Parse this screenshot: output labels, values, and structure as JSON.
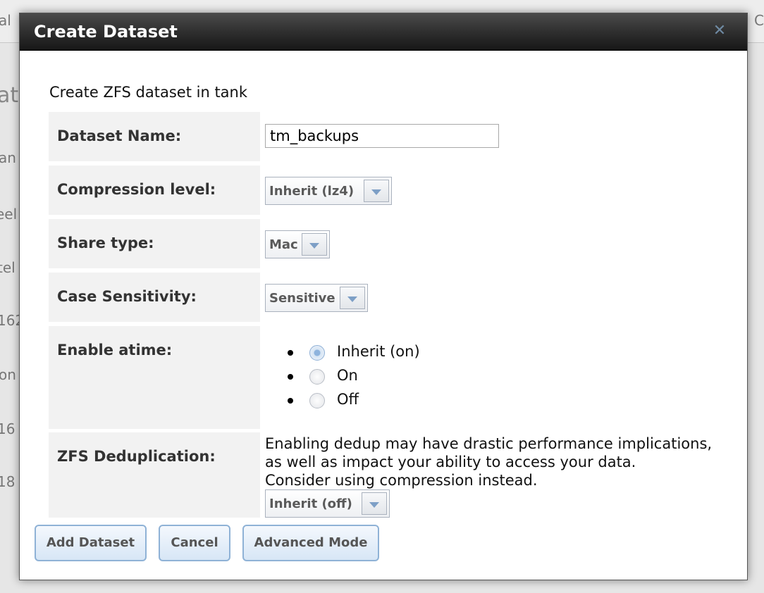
{
  "background": {
    "fragments": [
      "al",
      "C",
      "ati",
      "an",
      "eel",
      "tel",
      "162",
      "on",
      "16",
      "18"
    ]
  },
  "dialog": {
    "title": "Create Dataset",
    "close_icon": "close-icon",
    "subtitle": "Create ZFS dataset in tank",
    "fields": {
      "dataset_name": {
        "label": "Dataset Name:",
        "value": "tm_backups"
      },
      "compression": {
        "label": "Compression level:",
        "value": "Inherit (lz4)"
      },
      "share_type": {
        "label": "Share type:",
        "value": "Mac"
      },
      "case_sensitivity": {
        "label": "Case Sensitivity:",
        "value": "Sensitive"
      },
      "atime": {
        "label": "Enable atime:",
        "options": [
          "Inherit (on)",
          "On",
          "Off"
        ],
        "selected": "Inherit (on)"
      },
      "dedup": {
        "label": "ZFS Deduplication:",
        "note_lines": [
          "Enabling dedup may have drastic performance implications,",
          "as well as impact your ability to access your data.",
          "Consider using compression instead."
        ],
        "value": "Inherit (off)"
      }
    },
    "buttons": {
      "add": "Add Dataset",
      "cancel": "Cancel",
      "advanced": "Advanced Mode"
    }
  }
}
